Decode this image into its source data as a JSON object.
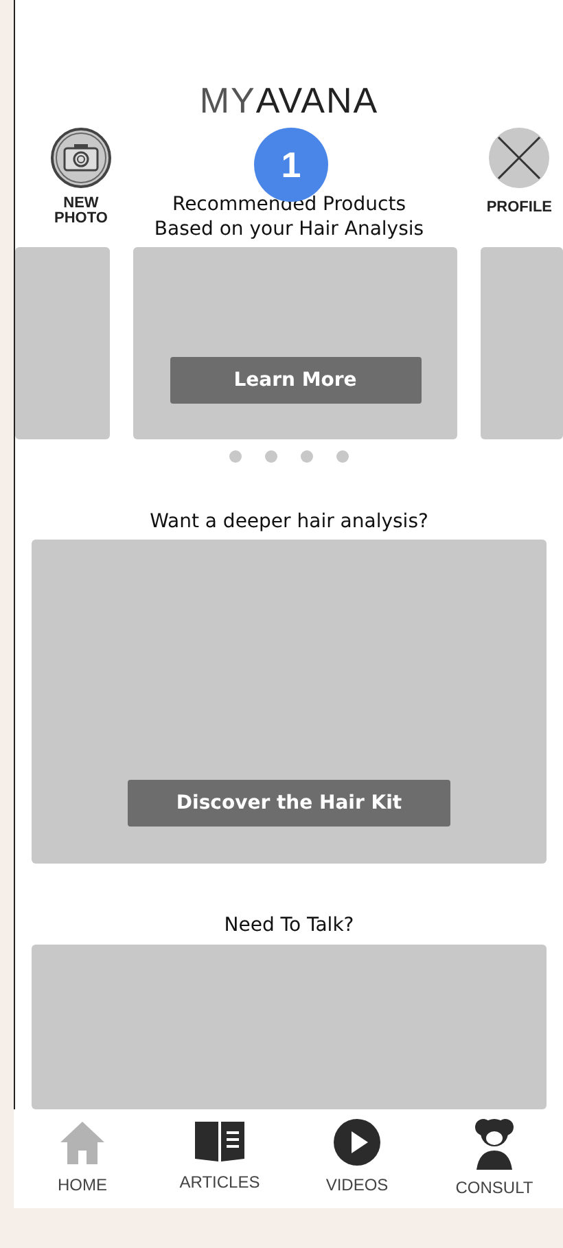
{
  "logo": {
    "light": "MY",
    "bold": "AVANA"
  },
  "header": {
    "new_photo": "NEW\nPHOTO",
    "profile": "PROFILE",
    "badge": "1"
  },
  "recommended": {
    "title": "Recommended Products\nBased on your Hair Analysis",
    "button": "Learn More",
    "dots": [
      {
        "selected": false
      },
      {
        "selected": false
      },
      {
        "selected": false
      },
      {
        "selected": false
      }
    ]
  },
  "analysis": {
    "title": "Want a deeper hair analysis?",
    "button": "Discover the Hair Kit"
  },
  "talk": {
    "title": "Need To Talk?"
  },
  "nav": [
    {
      "label": "HOME",
      "kind": "home",
      "selected": true
    },
    {
      "label": "ARTICLES",
      "kind": "articles",
      "selected": false
    },
    {
      "label": "VIDEOS",
      "kind": "videos",
      "selected": false
    },
    {
      "label": "CONSULT",
      "kind": "consult",
      "selected": false
    }
  ]
}
